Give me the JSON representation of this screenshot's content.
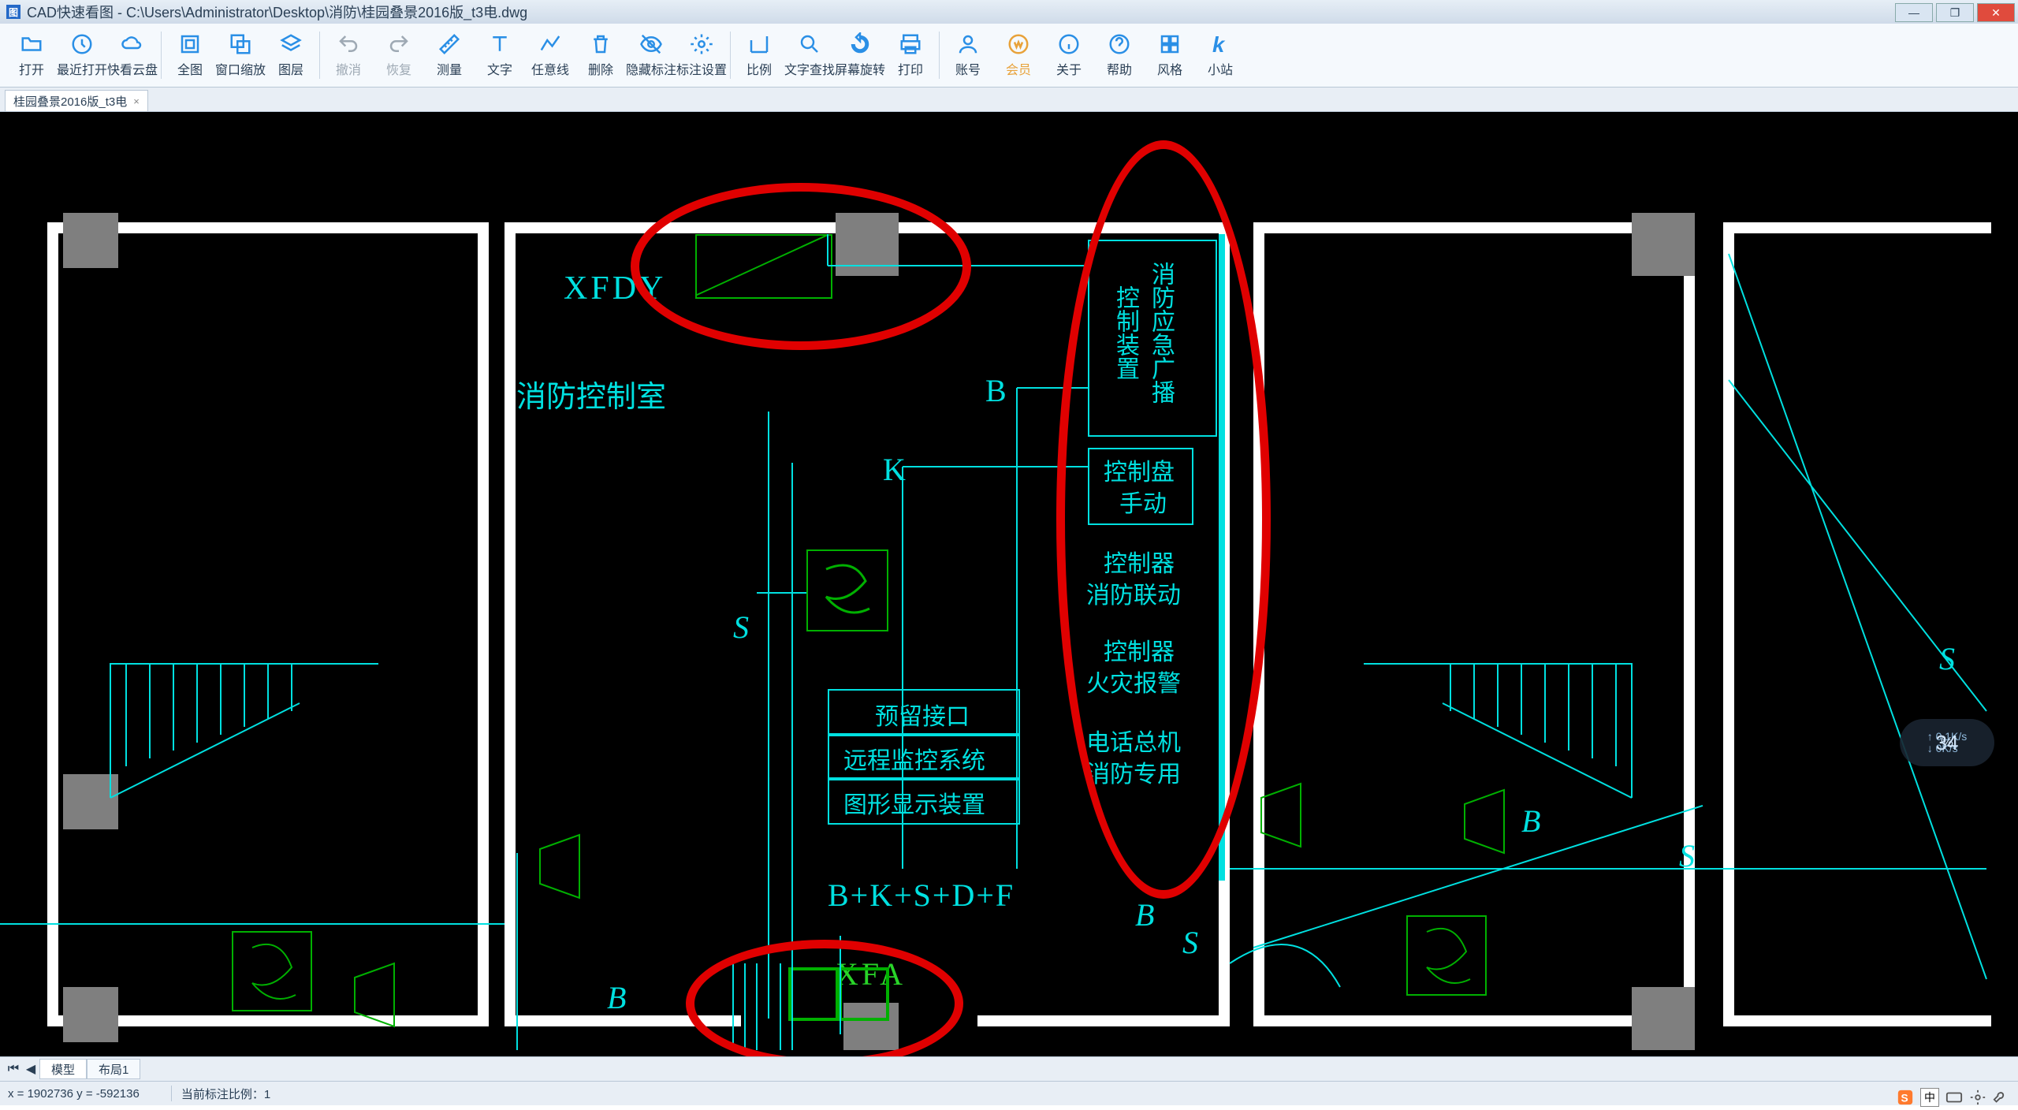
{
  "titlebar": {
    "title": "CAD快速看图 - C:\\Users\\Administrator\\Desktop\\消防\\桂园叠景2016版_t3电.dwg"
  },
  "toolbar": {
    "open": "打开",
    "recent": "最近打开",
    "cloud": "快看云盘",
    "full": "全图",
    "winzoom": "窗口缩放",
    "layer": "图层",
    "undo": "撤消",
    "redo": "恢复",
    "measure": "测量",
    "text": "文字",
    "polyline": "任意线",
    "delete": "删除",
    "hideanno": "隐藏标注",
    "annoset": "标注设置",
    "scale": "比例",
    "find": "文字查找",
    "rotate": "屏幕旋转",
    "print": "打印",
    "account": "账号",
    "vip": "会员",
    "about": "关于",
    "help": "帮助",
    "style": "风格",
    "kzhan": "小站"
  },
  "doctab": {
    "label": "桂园叠景2016版_t3电",
    "close": "×"
  },
  "drawing": {
    "xfdy": "XFDY",
    "room": "消防控制室",
    "b_label": "B",
    "k_label": "K",
    "s_label": "S",
    "reserve": "预留接口",
    "remote": "远程监控系统",
    "graphic": "图形显示装置",
    "formula": "B+K+S+D+F",
    "xfa": "XFA",
    "panel1a": "控制装置",
    "panel1b": "消防应急广播",
    "panel2a": "控制盘",
    "panel2b": "手动",
    "panel3a": "控制器",
    "panel3b": "消防联动",
    "panel4a": "控制器",
    "panel4b": "火灾报警",
    "panel5a": "电话总机",
    "panel5b": "消防专用",
    "right_b": "B",
    "right_s": "S",
    "far_s": "S",
    "left_b": "B"
  },
  "bottom": {
    "model": "模型",
    "layout1": "布局1"
  },
  "status": {
    "coords": "x = 1902736  y = -592136",
    "scale": "当前标注比例：1"
  },
  "hud": {
    "pct": "34",
    "pct_sym": "%",
    "up": "0.1K/s",
    "dn": "0K/s"
  },
  "tray": {
    "ime": "中"
  }
}
